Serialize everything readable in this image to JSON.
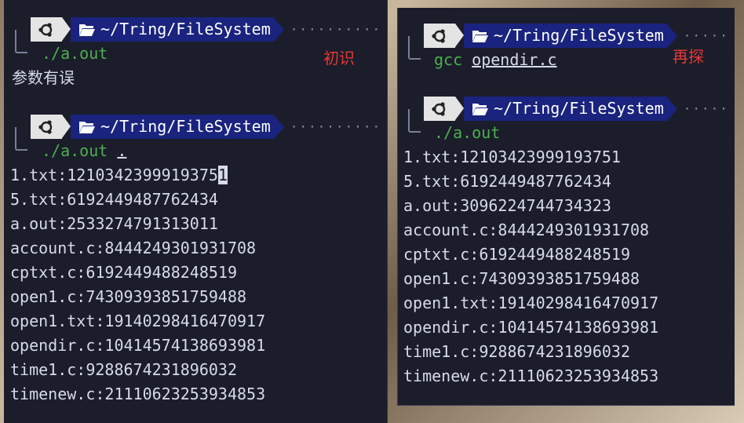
{
  "left_terminal": {
    "prompt1": {
      "path": "~/Tring/FileSystem",
      "command": "./a.out"
    },
    "error_output": "参数有误",
    "prompt2": {
      "path": "~/Tring/FileSystem",
      "command": "./a.out",
      "argument": "."
    },
    "output_lines": [
      "1.txt:1210342399919375",
      "5.txt:6192449487762434",
      "a.out:2533274791313011",
      "account.c:8444249301931708",
      "cptxt.c:6192449488248519",
      "open1.c:74309393851759488",
      "open1.txt:19140298416470917",
      "opendir.c:10414574138693981",
      "time1.c:9288674231896032",
      "timenew.c:21110623253934853"
    ],
    "cursor_char": "1",
    "annotation": "初识"
  },
  "right_terminal": {
    "prompt1": {
      "path": "~/Tring/FileSystem",
      "command": "gcc",
      "argument": "opendir.c"
    },
    "prompt2": {
      "path": "~/Tring/FileSystem",
      "command": "./a.out"
    },
    "output_lines": [
      "1.txt:12103423999193751",
      "5.txt:6192449487762434",
      "a.out:3096224744734323",
      "account.c:8444249301931708",
      "cptxt.c:6192449488248519",
      "open1.c:74309393851759488",
      "open1.txt:19140298416470917",
      "opendir.c:10414574138693981",
      "time1.c:9288674231896032",
      "timenew.c:21110623253934853"
    ],
    "annotation": "再探"
  },
  "icons": {
    "os": "ubuntu-icon",
    "folder": "folder-open-icon"
  },
  "colors": {
    "path_segment": "#1a237e",
    "os_segment": "#e4e4e4",
    "command": "#4caf4f",
    "annotation": "#e53935",
    "terminal_bg": "#1b1d2a"
  }
}
